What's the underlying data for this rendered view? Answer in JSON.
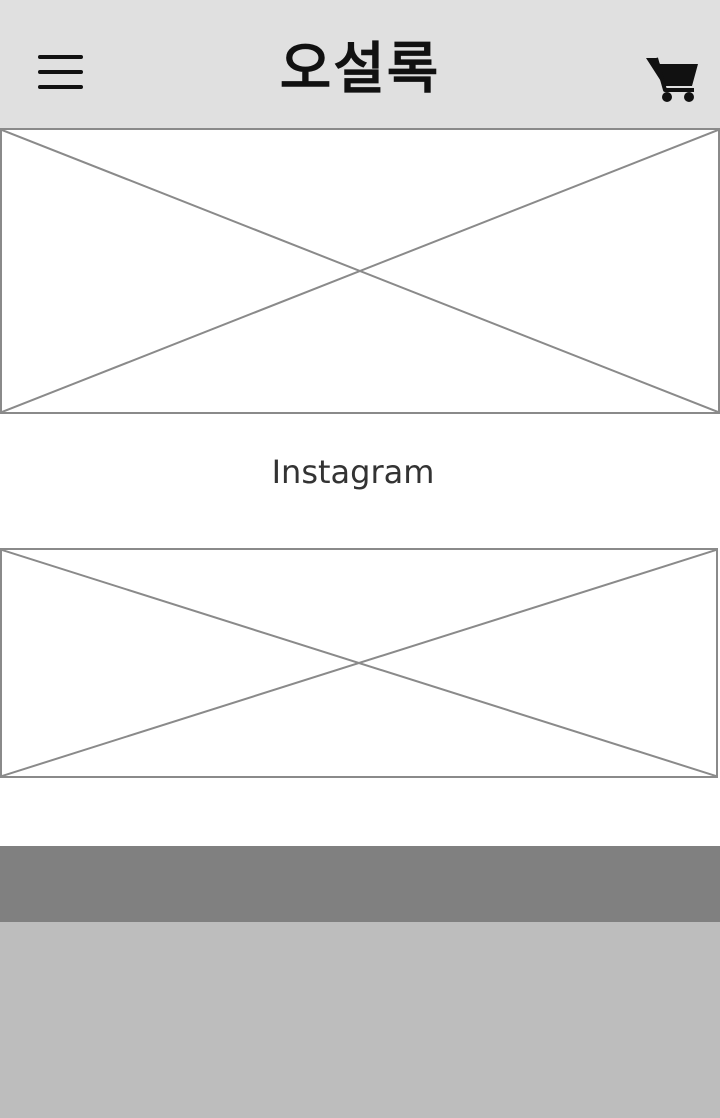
{
  "header": {
    "brand_title": "오설록",
    "menu_icon": "hamburger-menu-icon",
    "cart_icon": "shopping-cart-icon"
  },
  "main": {
    "top_banner": {
      "kind": "image-placeholder"
    },
    "section_title": "Instagram",
    "bottom_banner": {
      "kind": "image-placeholder"
    }
  },
  "colors": {
    "header_bg": "#e0e0e0",
    "footer_bar_bg": "#808080",
    "footer_bg": "#bdbdbd",
    "placeholder_stroke": "#8a8a8a",
    "text": "#333333"
  }
}
